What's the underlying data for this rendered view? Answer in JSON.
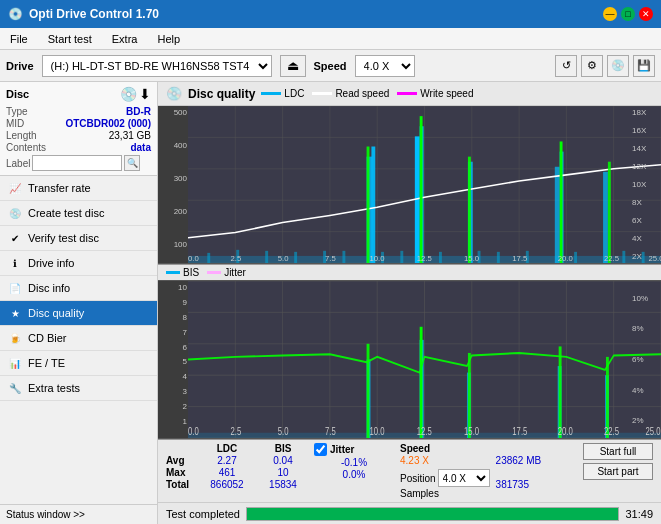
{
  "app": {
    "title": "Opti Drive Control 1.70",
    "icon": "💿"
  },
  "titlebar": {
    "title": "Opti Drive Control 1.70",
    "min": "—",
    "max": "□",
    "close": "✕"
  },
  "menu": {
    "items": [
      "File",
      "Start test",
      "Extra",
      "Help"
    ]
  },
  "drivebar": {
    "label": "Drive",
    "drive_value": "(H:)  HL-DT-ST BD-RE  WH16NS58 TST4",
    "speed_label": "Speed",
    "speed_value": "4.0 X"
  },
  "disc": {
    "title": "Disc",
    "type_label": "Type",
    "type_value": "BD-R",
    "mid_label": "MID",
    "mid_value": "OTCBDR002 (000)",
    "length_label": "Length",
    "length_value": "23,31 GB",
    "contents_label": "Contents",
    "contents_value": "data",
    "label_label": "Label",
    "label_value": ""
  },
  "nav": {
    "items": [
      {
        "id": "transfer-rate",
        "label": "Transfer rate",
        "icon": "📈"
      },
      {
        "id": "create-test-disc",
        "label": "Create test disc",
        "icon": "💿"
      },
      {
        "id": "verify-test-disc",
        "label": "Verify test disc",
        "icon": "✔"
      },
      {
        "id": "drive-info",
        "label": "Drive info",
        "icon": "ℹ"
      },
      {
        "id": "disc-info",
        "label": "Disc info",
        "icon": "📄"
      },
      {
        "id": "disc-quality",
        "label": "Disc quality",
        "icon": "★",
        "active": true
      },
      {
        "id": "cd-bier",
        "label": "CD Bier",
        "icon": "🍺"
      },
      {
        "id": "fe-te",
        "label": "FE / TE",
        "icon": "📊"
      },
      {
        "id": "extra-tests",
        "label": "Extra tests",
        "icon": "🔧"
      }
    ]
  },
  "status_window": {
    "label": "Status window >>",
    "status_text": "Test completed",
    "progress": 100,
    "time": "31:49"
  },
  "disc_quality": {
    "title": "Disc quality",
    "legend": {
      "ldc": "LDC",
      "read_speed": "Read speed",
      "write_speed": "Write speed",
      "bis": "BIS",
      "jitter": "Jitter"
    },
    "chart1": {
      "y_max": 500,
      "y_min": 0,
      "x_max": 25,
      "right_axis": [
        "18X",
        "16X",
        "14X",
        "12X",
        "10X",
        "8X",
        "6X",
        "4X",
        "2X"
      ]
    },
    "chart2": {
      "y_max": 10,
      "y_min": 0,
      "x_max": 25,
      "right_axis": [
        "10%",
        "8%",
        "6%",
        "4%",
        "2%"
      ]
    },
    "stats": {
      "headers": [
        "",
        "LDC",
        "BIS",
        "",
        "Jitter",
        "Speed",
        ""
      ],
      "avg_label": "Avg",
      "avg_ldc": "2.27",
      "avg_bis": "0.04",
      "avg_jitter": "-0.1%",
      "max_label": "Max",
      "max_ldc": "461",
      "max_bis": "10",
      "max_jitter": "0.0%",
      "total_label": "Total",
      "total_ldc": "866052",
      "total_bis": "15834",
      "position_label": "Position",
      "position_value": "23862 MB",
      "samples_label": "Samples",
      "samples_value": "381735",
      "speed_current": "4.23 X",
      "speed_select": "4.0 X",
      "jitter_checked": true
    },
    "buttons": {
      "start_full": "Start full",
      "start_part": "Start part"
    }
  }
}
